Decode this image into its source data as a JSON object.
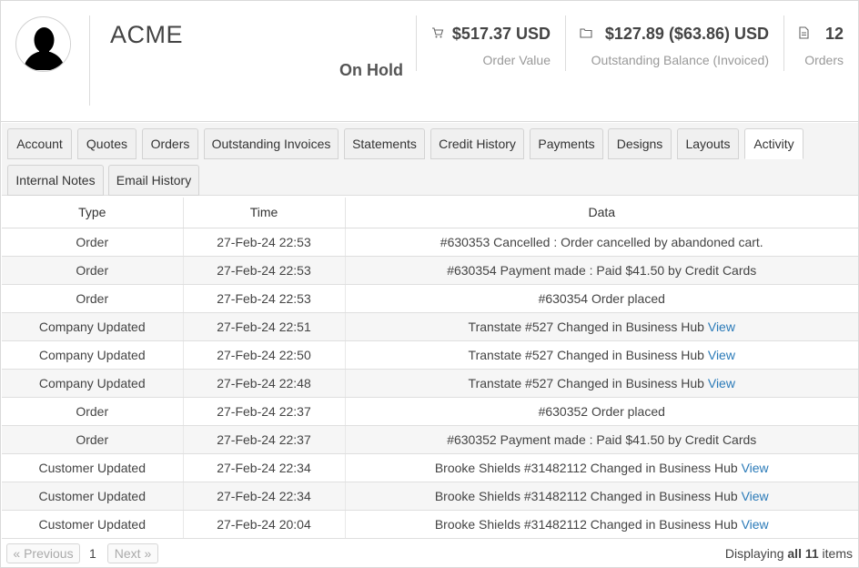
{
  "header": {
    "company": "ACME",
    "status": "On Hold",
    "stats": [
      {
        "icon": "cart-icon",
        "value": "$517.37 USD",
        "label": "Order Value"
      },
      {
        "icon": "folder-icon",
        "value": "$127.89 ($63.86) USD",
        "label": "Outstanding Balance (Invoiced)"
      },
      {
        "icon": "document-icon",
        "value": "12",
        "label": "Orders"
      }
    ]
  },
  "tabs": [
    {
      "label": "Account"
    },
    {
      "label": "Quotes"
    },
    {
      "label": "Orders"
    },
    {
      "label": "Outstanding Invoices"
    },
    {
      "label": "Statements"
    },
    {
      "label": "Credit History"
    },
    {
      "label": "Payments"
    },
    {
      "label": "Designs"
    },
    {
      "label": "Layouts"
    },
    {
      "label": "Activity",
      "active": true
    },
    {
      "label": "Internal Notes"
    },
    {
      "label": "Email History"
    }
  ],
  "table": {
    "columns": [
      "Type",
      "Time",
      "Data"
    ],
    "rows": [
      {
        "type": "Order",
        "time": "27-Feb-24 22:53",
        "data": "#630353 Cancelled : Order cancelled by abandoned cart.",
        "link": ""
      },
      {
        "type": "Order",
        "time": "27-Feb-24 22:53",
        "data": "#630354 Payment made : Paid $41.50 by Credit Cards",
        "link": ""
      },
      {
        "type": "Order",
        "time": "27-Feb-24 22:53",
        "data": "#630354 Order placed",
        "link": ""
      },
      {
        "type": "Company Updated",
        "time": "27-Feb-24 22:51",
        "data": "Transtate #527 Changed in Business Hub",
        "link": "View"
      },
      {
        "type": "Company Updated",
        "time": "27-Feb-24 22:50",
        "data": "Transtate #527 Changed in Business Hub",
        "link": "View"
      },
      {
        "type": "Company Updated",
        "time": "27-Feb-24 22:48",
        "data": "Transtate #527 Changed in Business Hub",
        "link": "View"
      },
      {
        "type": "Order",
        "time": "27-Feb-24 22:37",
        "data": "#630352 Order placed",
        "link": ""
      },
      {
        "type": "Order",
        "time": "27-Feb-24 22:37",
        "data": "#630352 Payment made : Paid $41.50 by Credit Cards",
        "link": ""
      },
      {
        "type": "Customer Updated",
        "time": "27-Feb-24 22:34",
        "data": "Brooke Shields #31482112 Changed in Business Hub",
        "link": "View"
      },
      {
        "type": "Customer Updated",
        "time": "27-Feb-24 22:34",
        "data": "Brooke Shields #31482112 Changed in Business Hub",
        "link": "View"
      },
      {
        "type": "Customer Updated",
        "time": "27-Feb-24 20:04",
        "data": "Brooke Shields #31482112 Changed in Business Hub",
        "link": "View"
      }
    ]
  },
  "pager": {
    "previous": "« Previous",
    "page": "1",
    "next": "Next »",
    "info_prefix": "Displaying",
    "info_bold": "all 11",
    "info_suffix": "items"
  },
  "colors": {
    "link": "#2a7ab8",
    "tab_bg": "#f0f0f0",
    "row_alt": "#f6f6f6"
  }
}
